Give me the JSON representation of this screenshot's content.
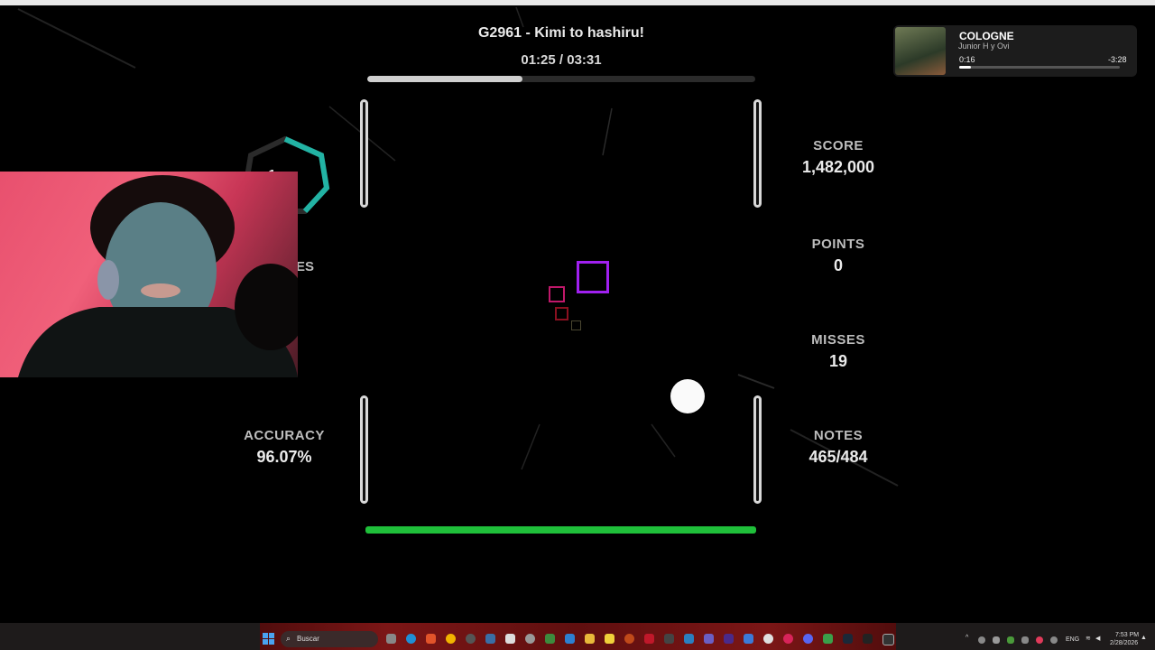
{
  "song": {
    "title": "G2961 - Kimi to hashiru!",
    "time": "01:25 / 03:31",
    "progress": 0.4
  },
  "stats": {
    "score_label": "SCORE",
    "score_value": "1,482,000",
    "points_label": "POINTS",
    "points_value": "0",
    "misses_label": "MISSES",
    "misses_value": "19",
    "notes_label": "NOTES",
    "notes_value": "465/484",
    "accuracy_label": "ACCURACY",
    "accuracy_value": "96.07%",
    "combo_partial": "1",
    "hidden_label_partial": "ES"
  },
  "now_playing": {
    "title": "COLOGNE",
    "artist": "Junior H y Ovi",
    "elapsed": "0:16",
    "remaining": "-3:28",
    "progress": 0.075
  },
  "taskbar": {
    "search_placeholder": "Buscar",
    "lang": "ENG",
    "clock_time": "7:53 PM",
    "clock_date": "2/28/2026"
  },
  "colors": {
    "accent_green": "#1fbf3a",
    "combo_ring": "#22b3a4",
    "note_purple": "#a020f0",
    "note_pink": "#c0186a",
    "note_red": "#8a1020",
    "note_olive": "#4a4630"
  }
}
